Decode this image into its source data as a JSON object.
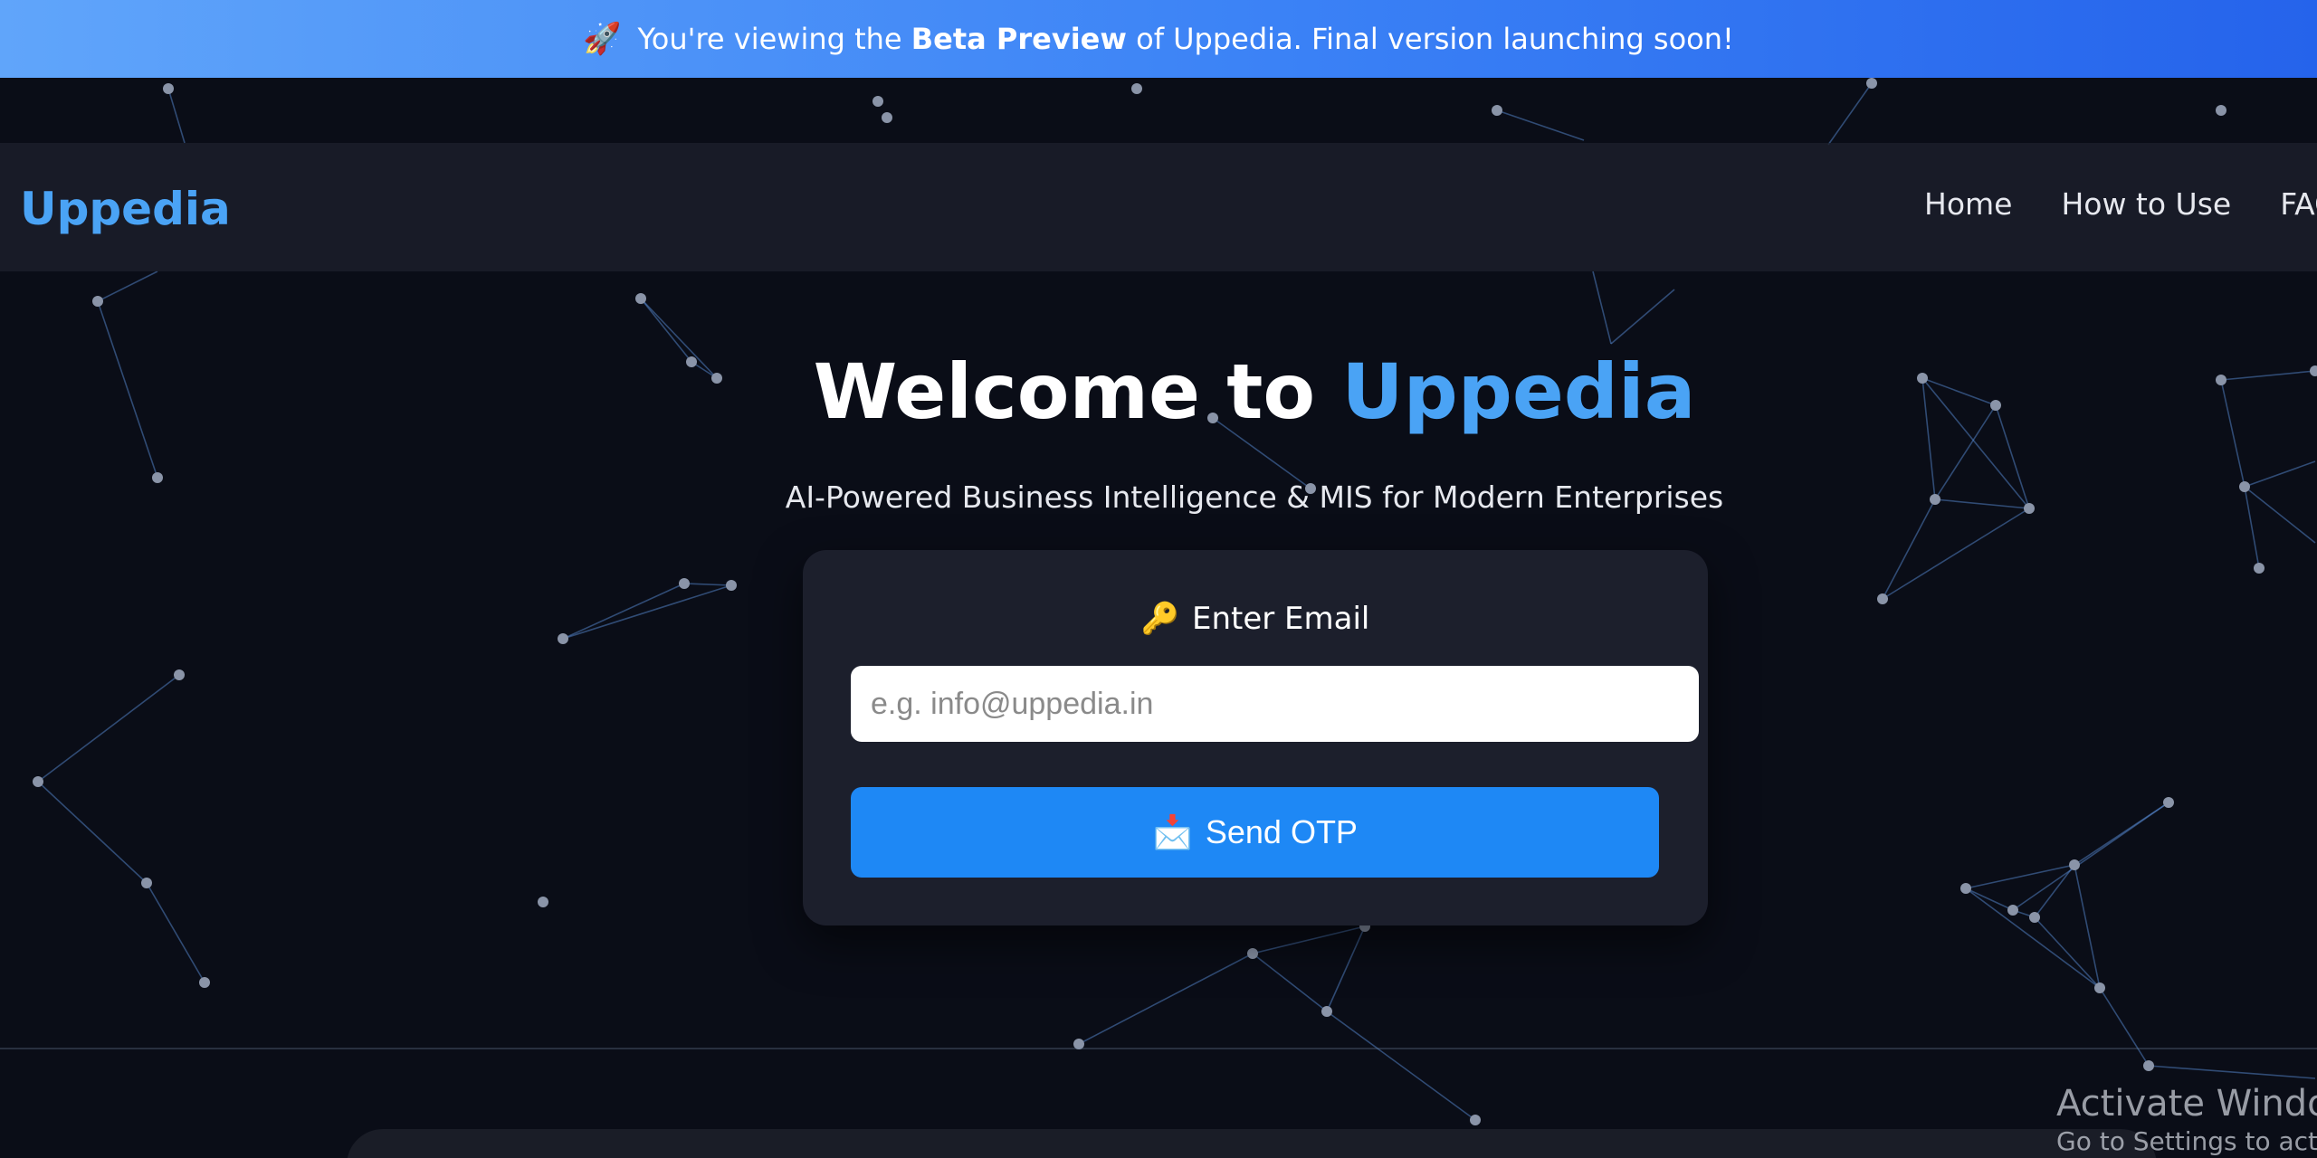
{
  "banner": {
    "icon": "rocket-icon",
    "emoji": "🚀",
    "text_before": "You're viewing the ",
    "text_strong": "Beta Preview",
    "text_after": " of Uppedia. Final version launching soon!"
  },
  "nav": {
    "logo": "Uppedia",
    "links": [
      "Home",
      "How to Use",
      "FAQ"
    ]
  },
  "hero": {
    "title_prefix": "Welcome to ",
    "title_brand": "Uppedia",
    "subtitle": "AI-Powered Business Intelligence & MIS for Modern Enterprises"
  },
  "login": {
    "label_icon": "key-icon",
    "label_emoji": "🔑",
    "label": "Enter Email",
    "email_placeholder": "e.g. info@uppedia.in",
    "email_value": "",
    "button_icon": "envelope-icon",
    "button_emoji": "📩",
    "button_label": "Send OTP"
  },
  "os_watermark": {
    "title": "Activate Windows",
    "subtitle": "Go to Settings to activate Windows."
  },
  "colors": {
    "background": "#0a0d17",
    "brand": "#4aa3f5",
    "button": "#1e88f5",
    "banner_start": "#60a5fa",
    "banner_end": "#2563eb",
    "card": "#1c1f2c"
  }
}
